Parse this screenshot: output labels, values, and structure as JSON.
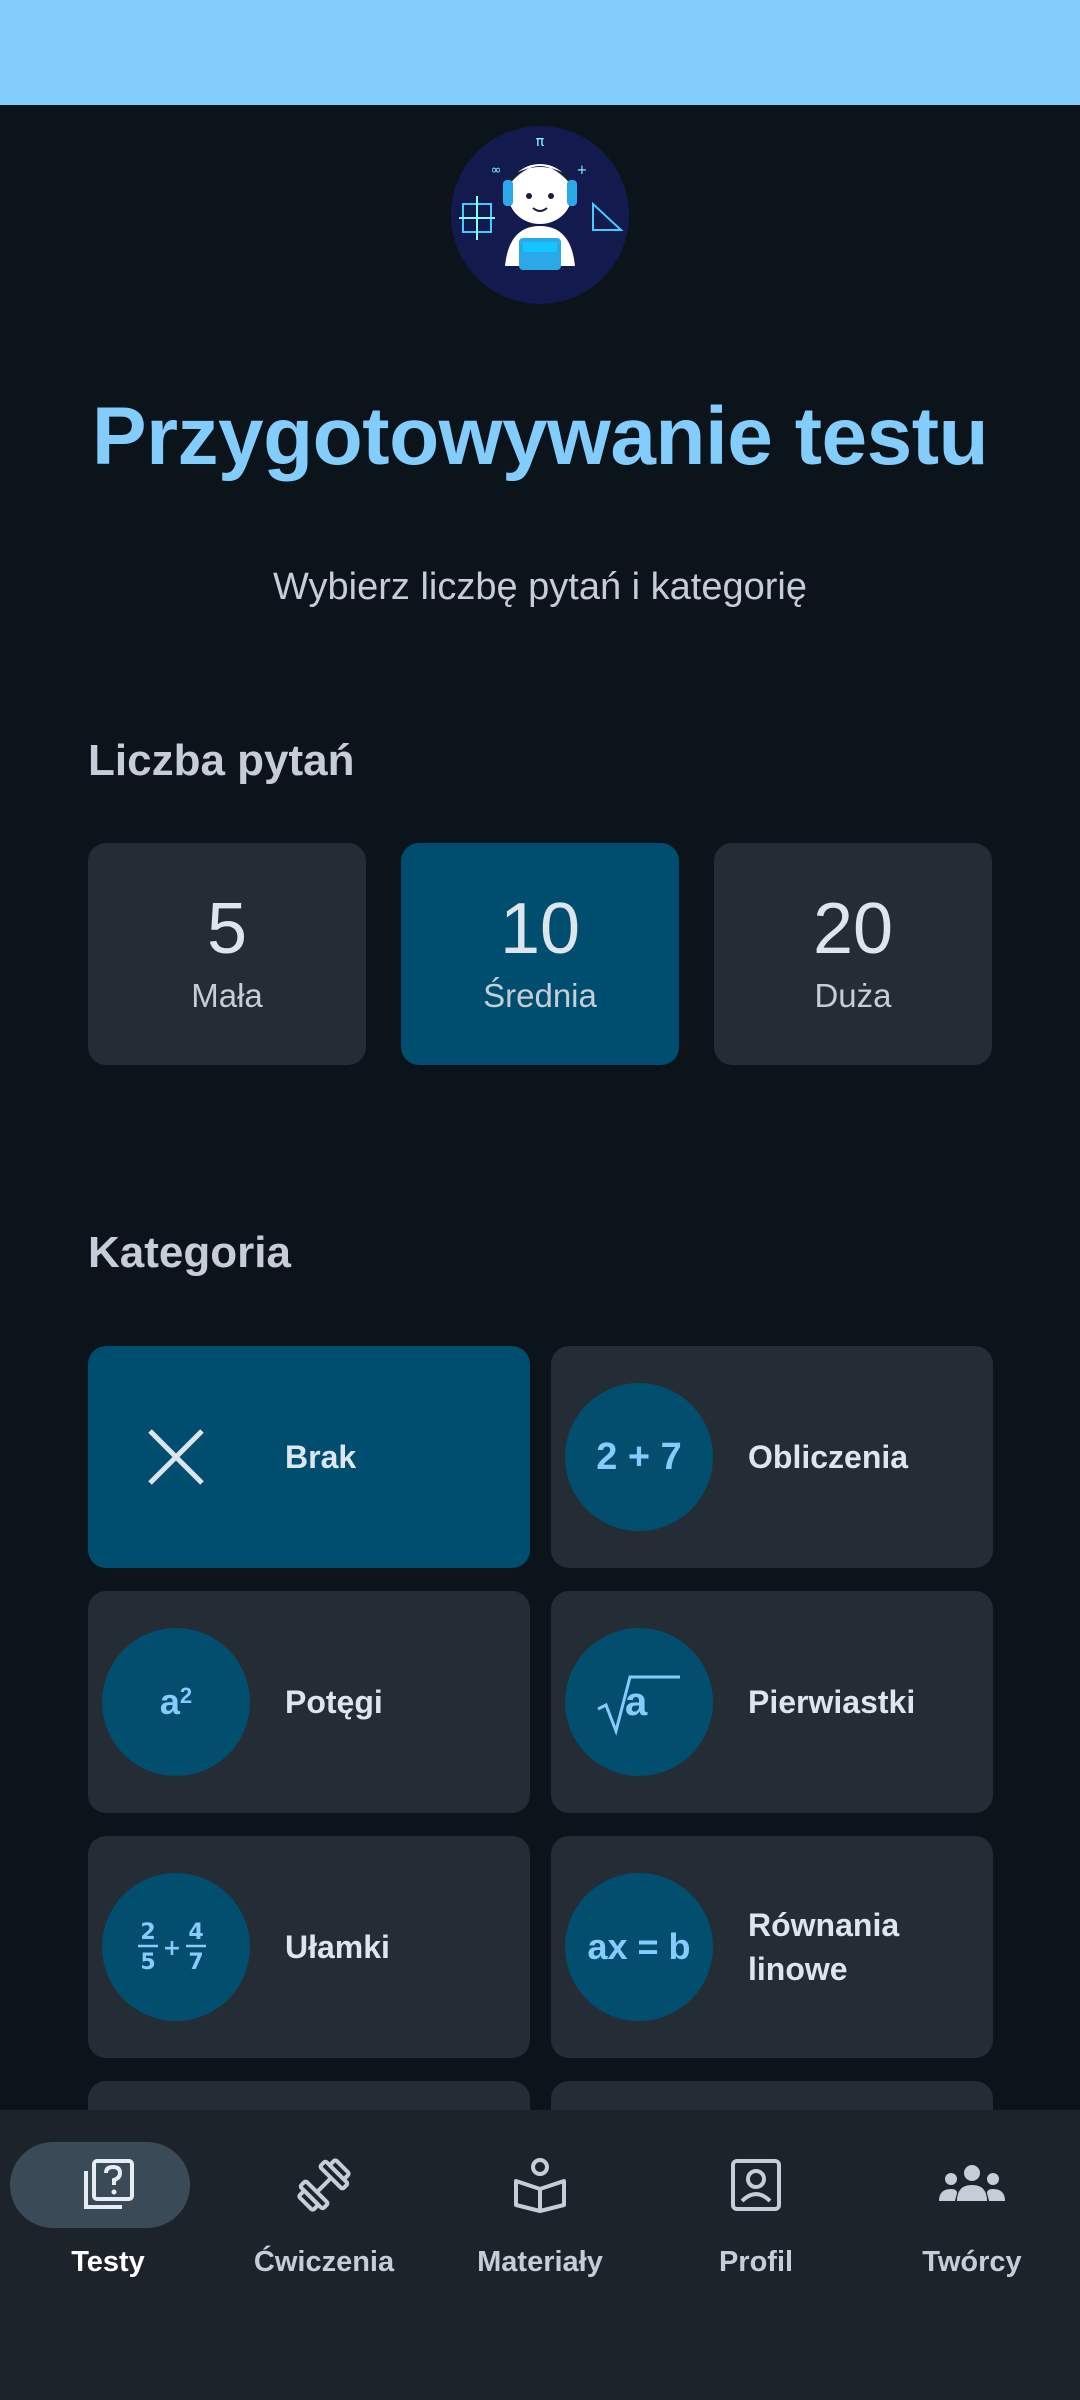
{
  "header": {
    "title": "Przygotowywanie testu",
    "subtitle": "Wybierz liczbę pytań i kategorię"
  },
  "question_count": {
    "label": "Liczba pytań",
    "selected": "10",
    "options": [
      {
        "value": "5",
        "label": "Mała"
      },
      {
        "value": "10",
        "label": "Średnia"
      },
      {
        "value": "20",
        "label": "Duża"
      }
    ]
  },
  "category": {
    "label": "Kategoria",
    "selected": "Brak",
    "options": [
      {
        "label": "Brak",
        "icon": "close-icon"
      },
      {
        "label": "Obliczenia",
        "icon_text": "2 + 7"
      },
      {
        "label": "Potęgi",
        "icon_text": "a",
        "icon_sup": "2"
      },
      {
        "label": "Pierwiastki",
        "icon_text": "a",
        "icon": "square-root-icon"
      },
      {
        "label": "Ułamki",
        "icon_text": "2/5 + 4/7"
      },
      {
        "label": "Równania linowe",
        "icon_text": "ax = b"
      }
    ]
  },
  "bottom_nav": {
    "active": "Testy",
    "items": [
      {
        "label": "Testy",
        "icon": "quiz-icon"
      },
      {
        "label": "Ćwiczenia",
        "icon": "dumbbell-icon"
      },
      {
        "label": "Materiały",
        "icon": "reading-icon"
      },
      {
        "label": "Profil",
        "icon": "profile-icon"
      },
      {
        "label": "Twórcy",
        "icon": "group-icon"
      }
    ]
  },
  "colors": {
    "accent": "#83cdfd",
    "selected_card": "#004e6f",
    "card": "#242c35",
    "background": "#0b131b",
    "nav_background": "#1d232a"
  }
}
